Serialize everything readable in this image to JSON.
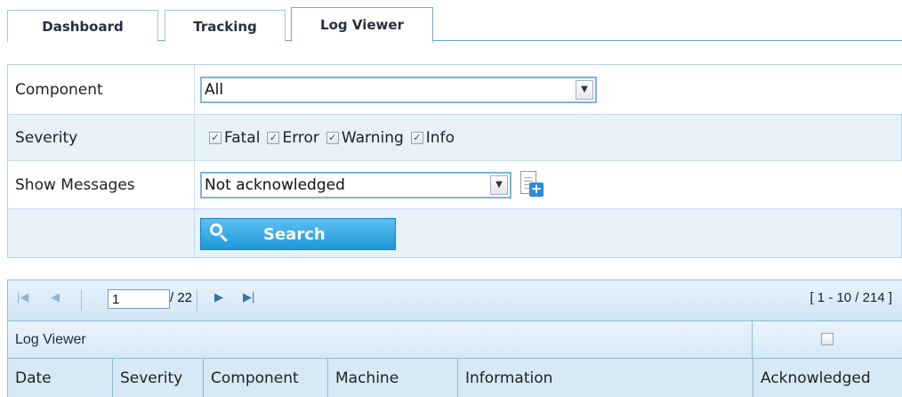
{
  "tabs": [
    {
      "label": "Dashboard",
      "active": false
    },
    {
      "label": "Tracking",
      "active": false
    },
    {
      "label": "Log Viewer",
      "active": true
    }
  ],
  "filter": {
    "component": {
      "label": "Component",
      "value": "All"
    },
    "severity": {
      "label": "Severity",
      "options": [
        {
          "label": "Fatal",
          "checked": true
        },
        {
          "label": "Error",
          "checked": true
        },
        {
          "label": "Warning",
          "checked": true
        },
        {
          "label": "Info",
          "checked": true
        }
      ]
    },
    "show_messages": {
      "label": "Show Messages",
      "value": "Not acknowledged"
    },
    "search_label": "Search"
  },
  "grid": {
    "pager": {
      "page": "1",
      "total_pages": "/ 22",
      "range": "[ 1 - 10 / 214 ]"
    },
    "caption": "Log Viewer",
    "columns": [
      "Date",
      "Severity",
      "Component",
      "Machine",
      "Information",
      "Acknowledged"
    ]
  },
  "colors": {
    "accent": "#1e97da",
    "panel": "#e6f1f9",
    "border": "#8fbbdb"
  }
}
